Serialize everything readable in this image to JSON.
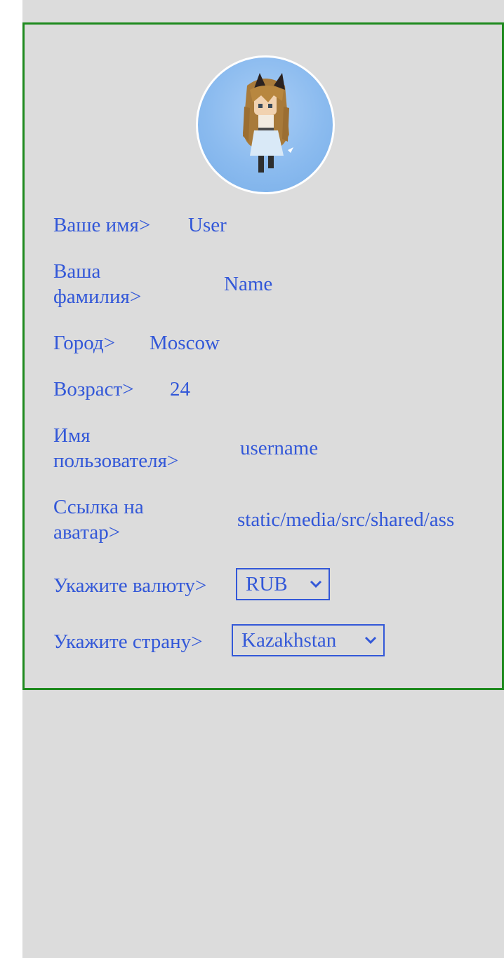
{
  "profile": {
    "avatar_icon": "avatar-anime-girl-icon",
    "fields": [
      {
        "label": "Ваше имя>",
        "value": "User"
      },
      {
        "label": "Ваша фамилия>",
        "value": "Name"
      },
      {
        "label": "Город>",
        "value": "Moscow"
      },
      {
        "label": "Возраст>",
        "value": "24"
      },
      {
        "label": "Имя пользователя>",
        "value": "username"
      },
      {
        "label": "Ссылка на аватар>",
        "value": "static/media/src/shared/ass"
      }
    ],
    "currency": {
      "label": "Укажите валюту>",
      "selected": "RUB"
    },
    "country": {
      "label": "Укажите страну>",
      "selected": "Kazakhstan"
    }
  },
  "colors": {
    "accent": "#3358d8",
    "card_border": "#1e8a1e",
    "background": "#dcdcdc"
  }
}
